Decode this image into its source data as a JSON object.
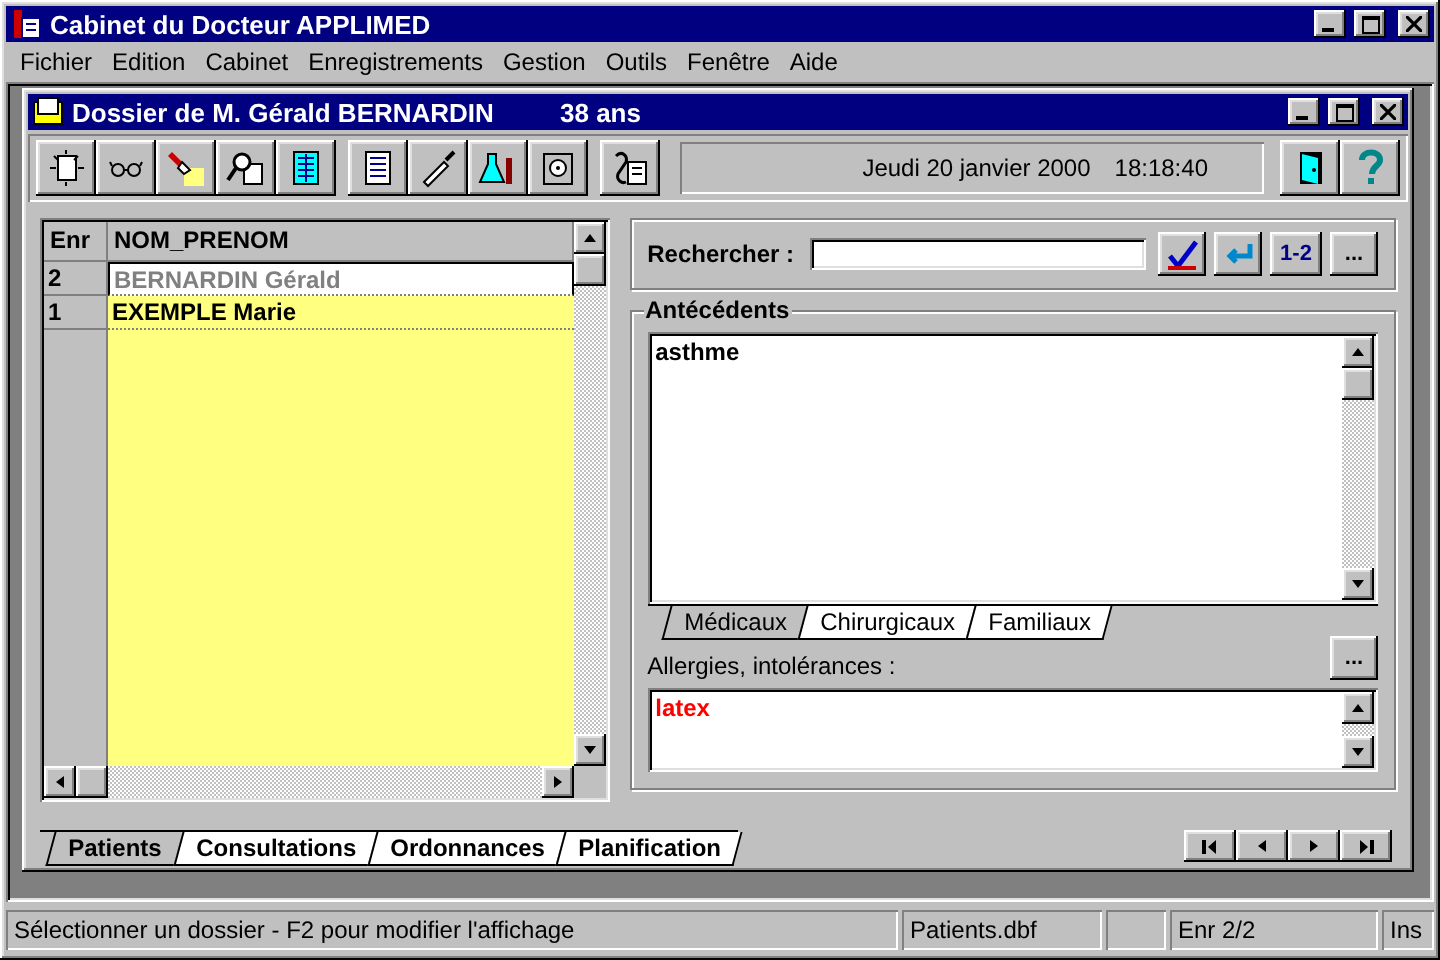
{
  "app": {
    "title": "Cabinet du Docteur APPLIMED"
  },
  "menu": [
    "Fichier",
    "Edition",
    "Cabinet",
    "Enregistrements",
    "Gestion",
    "Outils",
    "Fenêtre",
    "Aide"
  ],
  "child": {
    "title": "Dossier de M. Gérald BERNARDIN",
    "age": "38 ans"
  },
  "toolbar": {
    "date": "Jeudi 20 janvier 2000",
    "time": "18:18:40"
  },
  "grid": {
    "columns": [
      "Enr",
      "NOM_PRENOM"
    ],
    "rows": [
      {
        "enr": "2",
        "name": "BERNARDIN Gérald",
        "selected": true
      },
      {
        "enr": "1",
        "name": "EXEMPLE Marie",
        "selected": false
      }
    ]
  },
  "search": {
    "label": "Rechercher :",
    "order_button": "1-2",
    "more_button": "..."
  },
  "antecedents": {
    "title": "Antécédents",
    "text": "asthme",
    "tabs": [
      {
        "label": "Médicaux",
        "selected": true
      },
      {
        "label": "Chirurgicaux",
        "selected": false
      },
      {
        "label": "Familiaux",
        "selected": false
      }
    ],
    "more_button": "...",
    "allergies_label": "Allergies, intolérances :",
    "allergies": "latex"
  },
  "bottom_tabs": [
    {
      "label": "Patients",
      "selected": true
    },
    {
      "label": "Consultations",
      "selected": false
    },
    {
      "label": "Ordonnances",
      "selected": false
    },
    {
      "label": "Planification",
      "selected": false
    }
  ],
  "status_bar": {
    "message": "Sélectionner un dossier - F2 pour modifier l'affichage",
    "file": "Patients.dbf",
    "record": "Enr 2/2",
    "mode": "Ins"
  }
}
